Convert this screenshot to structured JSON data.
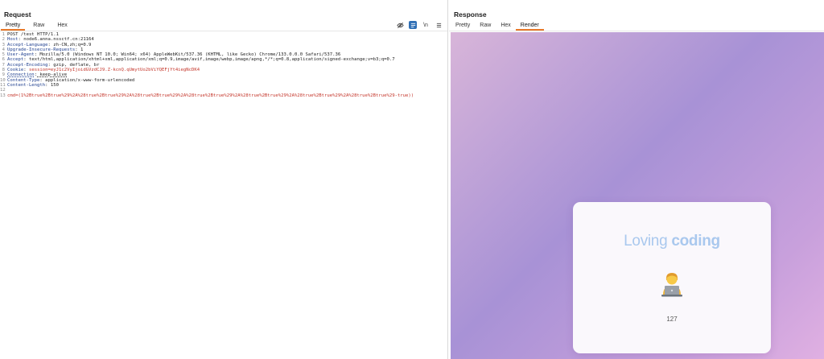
{
  "request": {
    "title": "Request",
    "tabs": [
      "Pretty",
      "Raw",
      "Hex"
    ],
    "toolbar_icons": [
      "eye-off-icon",
      "wrap-lines-icon",
      "newline-icon",
      "menu-icon"
    ],
    "newline_label": "\\n",
    "lines": [
      {
        "n": "1",
        "name": "",
        "value": "POST /test HTTP/1.1"
      },
      {
        "n": "2",
        "name": "Host",
        "value": " node6.anna.nssctf.cn:21164"
      },
      {
        "n": "3",
        "name": "Accept-Language",
        "value": " zh-CN,zh;q=0.9"
      },
      {
        "n": "4",
        "name": "Upgrade-Insecure-Requests",
        "value": " 1"
      },
      {
        "n": "5",
        "name": "User-Agent",
        "value": " Mozilla/5.0 (Windows NT 10.0; Win64; x64) AppleWebKit/537.36 (KHTML, like Gecko) Chrome/133.0.0.0 Safari/537.36"
      },
      {
        "n": "6",
        "name": "Accept",
        "value": " text/html,application/xhtml+xml,application/xml;q=0.9,image/avif,image/webp,image/apng,*/*;q=0.8,application/signed-exchange;v=b3;q=0.7"
      },
      {
        "n": "7",
        "name": "Accept-Encoding",
        "value": " gzip, deflate, br"
      },
      {
        "n": "8",
        "name": "Cookie",
        "value": " session=eyJ1c2VyIjoidGVzdCJ9.Z-kcnQ.qUmytUo2bViYQEFjYt4iegNcDK4"
      },
      {
        "n": "9",
        "name": "Connection",
        "value": " keep-alive"
      },
      {
        "n": "10",
        "name": "Content-Type",
        "value": " application/x-www-form-urlencoded"
      },
      {
        "n": "11",
        "name": "Content-Length",
        "value": " 150"
      },
      {
        "n": "12",
        "name": "",
        "value": ""
      },
      {
        "n": "13",
        "name": "",
        "value": "cmd=(1%2Btrue%2Btrue%29%2A%28true%2Btrue%29%2A%28true%2Btrue%29%2A%28true%2Btrue%29%2A%28true%2Btrue%29%2A%28true%2Btrue%29%2A%28true%2Btrue%29-true))"
      }
    ]
  },
  "response": {
    "title": "Response",
    "tabs": [
      "Pretty",
      "Raw",
      "Hex",
      "Render"
    ],
    "active_tab": "Render",
    "render": {
      "heading_bold": "Loving",
      "heading_light": "coding",
      "emoji": "person-technologist-emoji",
      "count": "127"
    }
  },
  "colors": {
    "accent": "#e8792a",
    "header_name": "#1f3f8f",
    "value_red": "#c4352a",
    "heading": "#a9c8ee"
  }
}
